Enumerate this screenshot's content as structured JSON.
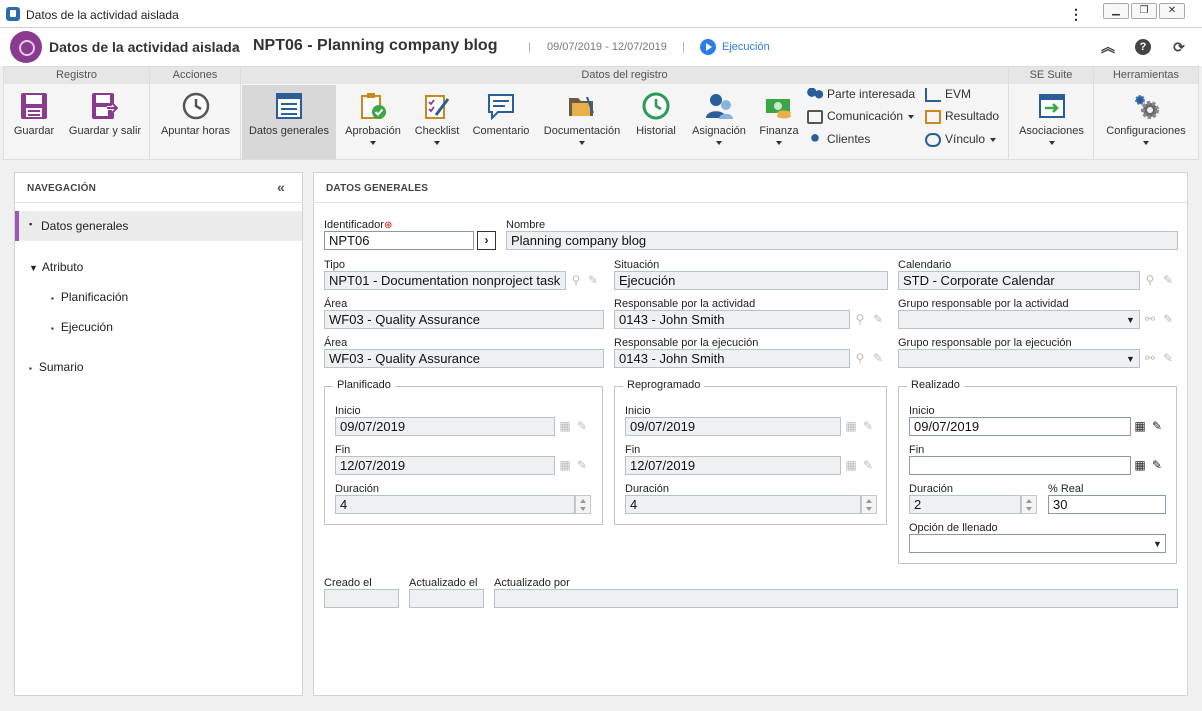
{
  "window": {
    "title": "Datos de la actividad aislada"
  },
  "header": {
    "crumb_parent": "Datos de la actividad aislada",
    "separator": "›",
    "crumb_current": "NPT06 - Planning company blog",
    "dates": "09/07/2019 - 12/07/2019",
    "status": "Ejecución"
  },
  "ribbon": {
    "groups": {
      "registro": "Registro",
      "acciones": "Acciones",
      "datos": "Datos del registro",
      "suite": "SE Suite",
      "herramientas": "Herramientas"
    },
    "buttons": {
      "guardar": "Guardar",
      "guardar_salir": "Guardar y salir",
      "apuntar_horas": "Apuntar horas",
      "datos_generales": "Datos generales",
      "aprobacion": "Aprobación",
      "checklist": "Checklist",
      "comentario": "Comentario",
      "documentacion": "Documentación",
      "historial": "Historial",
      "asignacion": "Asignación",
      "finanza": "Finanza",
      "parte_interesada": "Parte interesada",
      "comunicacion": "Comunicación",
      "clientes": "Clientes",
      "evm": "EVM",
      "resultado": "Resultado",
      "vinculo": "Vínculo",
      "asociaciones": "Asociaciones",
      "configuraciones": "Configuraciones"
    }
  },
  "nav": {
    "title": "NAVEGACIÓN",
    "items": {
      "datos_generales": "Datos generales",
      "atributo": "Atributo",
      "planificacion": "Planificación",
      "ejecucion": "Ejecución",
      "sumario": "Sumario"
    }
  },
  "form": {
    "title": "DATOS GENERALES",
    "identificador": {
      "label": "Identificador",
      "value": "NPT06"
    },
    "nombre": {
      "label": "Nombre",
      "value": "Planning company blog"
    },
    "tipo": {
      "label": "Tipo",
      "value": "NPT01 - Documentation nonproject task"
    },
    "situacion": {
      "label": "Situación",
      "value": "Ejecución"
    },
    "calendario": {
      "label": "Calendario",
      "value": "STD - Corporate Calendar"
    },
    "area1": {
      "label": "Área",
      "value": "WF03 - Quality Assurance"
    },
    "resp_actividad": {
      "label": "Responsable por la actividad",
      "value": "0143 - John Smith"
    },
    "grupo_actividad": {
      "label": "Grupo responsable por la actividad",
      "value": ""
    },
    "area2": {
      "label": "Área",
      "value": "WF03 - Quality Assurance"
    },
    "resp_ejecucion": {
      "label": "Responsable por la ejecución",
      "value": "0143 - John Smith"
    },
    "grupo_ejecucion": {
      "label": "Grupo responsable por la ejecución",
      "value": ""
    },
    "planificado": {
      "legend": "Planificado",
      "inicio_label": "Inicio",
      "inicio": "09/07/2019",
      "fin_label": "Fin",
      "fin": "12/07/2019",
      "duracion_label": "Duración",
      "duracion": "4"
    },
    "reprogramado": {
      "legend": "Reprogramado",
      "inicio_label": "Inicio",
      "inicio": "09/07/2019",
      "fin_label": "Fin",
      "fin": "12/07/2019",
      "duracion_label": "Duración",
      "duracion": "4"
    },
    "realizado": {
      "legend": "Realizado",
      "inicio_label": "Inicio",
      "inicio": "09/07/2019",
      "fin_label": "Fin",
      "fin": "",
      "duracion_label": "Duración",
      "duracion": "2",
      "real_label": "% Real",
      "real": "30",
      "opcion_label": "Opción de llenado",
      "opcion": ""
    },
    "creado_label": "Creado el",
    "creado": "",
    "actualizado_label": "Actualizado el",
    "actualizado": "",
    "actualizado_por_label": "Actualizado por",
    "actualizado_por": ""
  },
  "colors": {
    "accent": "#9b59b6",
    "brand": "#8a3a8f",
    "status": "#2b7de9"
  }
}
